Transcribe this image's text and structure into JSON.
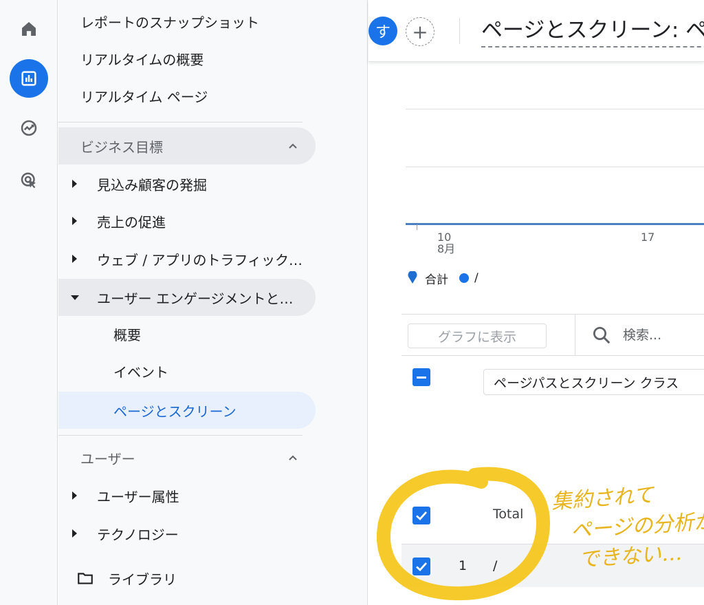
{
  "rail": {
    "items": [
      {
        "icon": "home-icon"
      },
      {
        "icon": "reports-icon",
        "active": true
      },
      {
        "icon": "explore-icon"
      },
      {
        "icon": "advertising-icon"
      }
    ]
  },
  "nav": {
    "top_items": [
      "レポートのスナップショット",
      "リアルタイムの概要",
      "リアルタイム ページ"
    ],
    "section_business": "ビジネス目標",
    "business_items": [
      "見込み顧客の発掘",
      "売上の促進",
      "ウェブ / アプリのトラフィック…",
      "ユーザー エンゲージメントと…"
    ],
    "engagement_children": [
      "概要",
      "イベント",
      "ページとスクリーン"
    ],
    "section_user": "ユーザー",
    "user_items": [
      "ユーザー属性",
      "テクノロジー"
    ],
    "library": "ライブラリ"
  },
  "header": {
    "avatar_letter": "す",
    "add_symbol": "+",
    "title": "ページとスクリーン: ペ"
  },
  "chart": {
    "tick_1_day": "10",
    "tick_1_month": "8月",
    "tick_2_day": "17",
    "legend_total": "合計",
    "legend_series": "/",
    "accent": "#1a73e8"
  },
  "table": {
    "graph_button": "グラフに表示",
    "search_placeholder": "検索...",
    "dimension_select": "ページパスとスクリーン クラス",
    "total_label": "Total",
    "row_number": "1",
    "row_path": "/"
  },
  "annotation": {
    "line1": "集約されて",
    "line2": "ページの分析が",
    "line3": "できない…",
    "color": "#f5c518"
  }
}
